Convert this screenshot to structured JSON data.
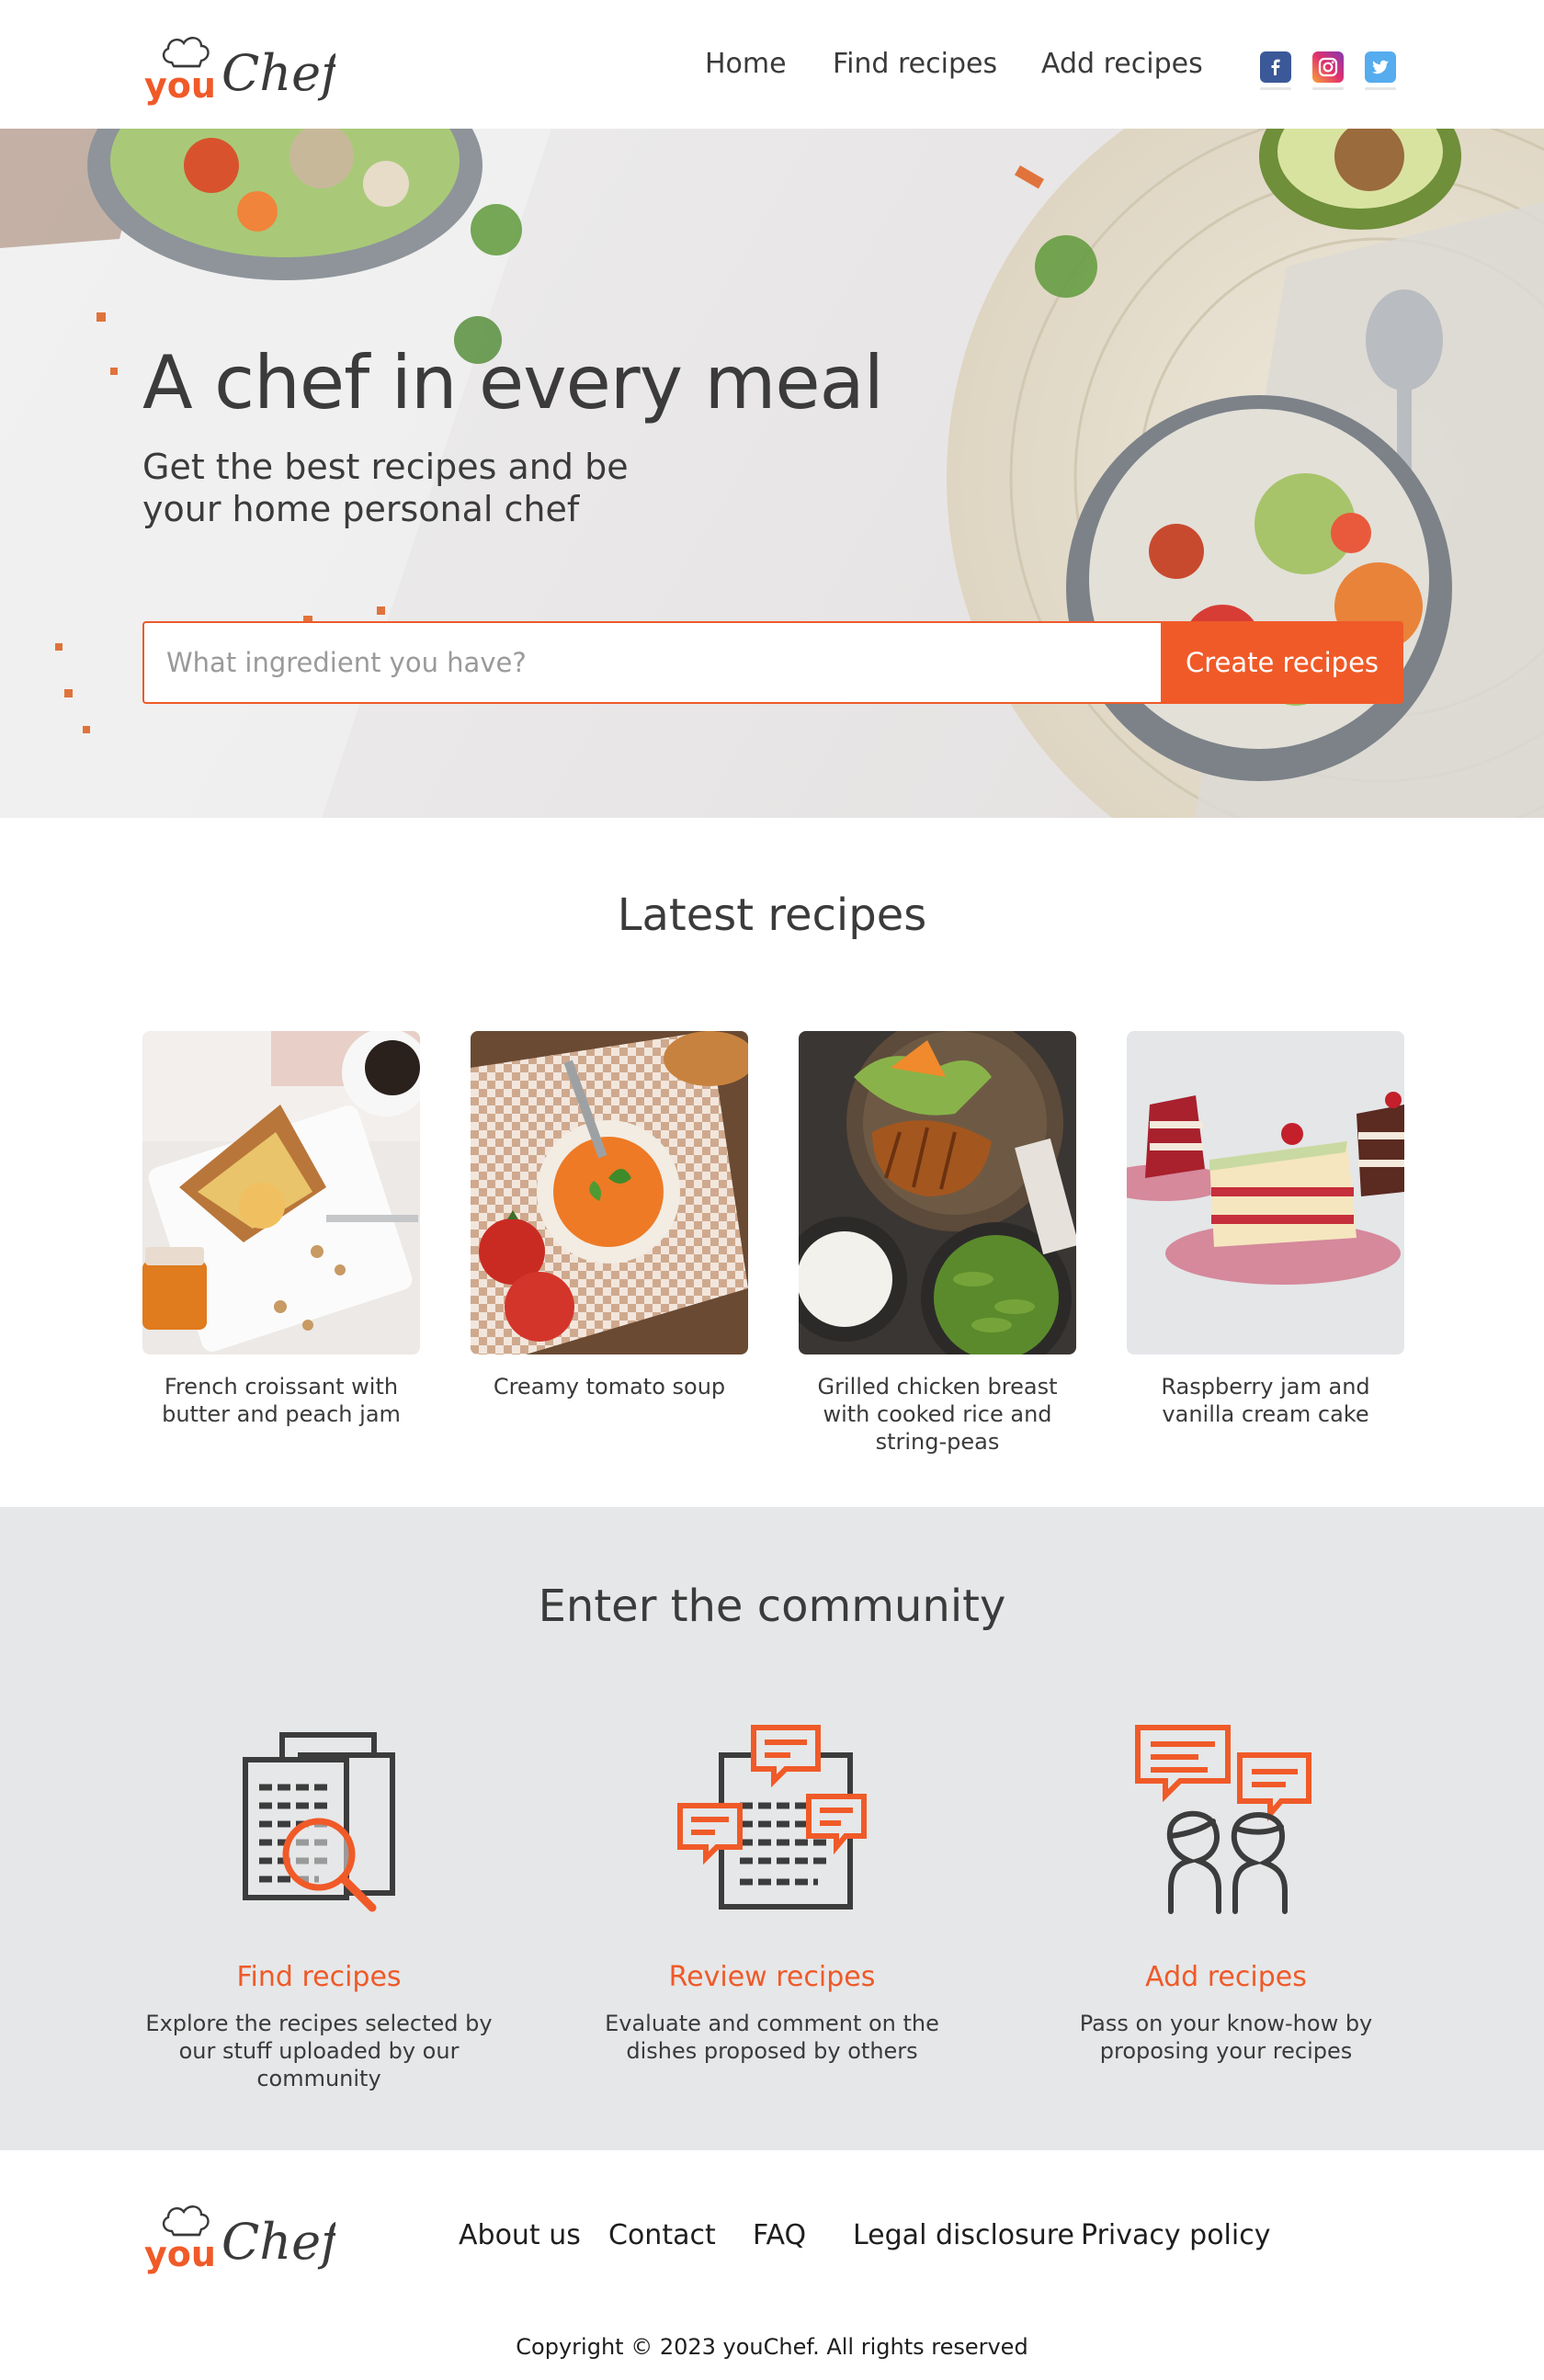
{
  "brand": {
    "name_you": "you",
    "name_chef": "Chef"
  },
  "nav": {
    "home": "Home",
    "find": "Find recipes",
    "add": "Add recipes"
  },
  "social": {
    "facebook": "facebook-icon",
    "instagram": "instagram-icon",
    "twitter": "twitter-icon"
  },
  "hero": {
    "title": "A chef in every meal",
    "subtitle": "Get the best recipes and be your home personal chef",
    "search_placeholder": "What ingredient you have?",
    "search_value": "",
    "cta": "Create recipes"
  },
  "latest": {
    "title": "Latest recipes",
    "cards": [
      {
        "caption": "French croissant with butter and peach jam"
      },
      {
        "caption": "Creamy tomato soup"
      },
      {
        "caption": "Grilled chicken breast with cooked rice and string-peas"
      },
      {
        "caption": "Raspberry jam and vanilla cream cake"
      }
    ]
  },
  "community": {
    "title": "Enter the community",
    "features": [
      {
        "title": "Find recipes",
        "desc": "Explore the recipes selected by our stuff uploaded by our community"
      },
      {
        "title": "Review recipes",
        "desc": "Evaluate and comment on the dishes proposed by others"
      },
      {
        "title": "Add recipes",
        "desc": "Pass on your know-how by proposing your recipes"
      }
    ]
  },
  "footer": {
    "links": [
      "About us",
      "Contact",
      "FAQ",
      "Legal disclosure",
      "Privacy policy"
    ],
    "copyright": "Copyright © 2023 youChef. All rights reserved"
  },
  "colors": {
    "accent": "#f05a28",
    "text": "#3b3b3b",
    "community_bg": "#e6e7e8"
  }
}
